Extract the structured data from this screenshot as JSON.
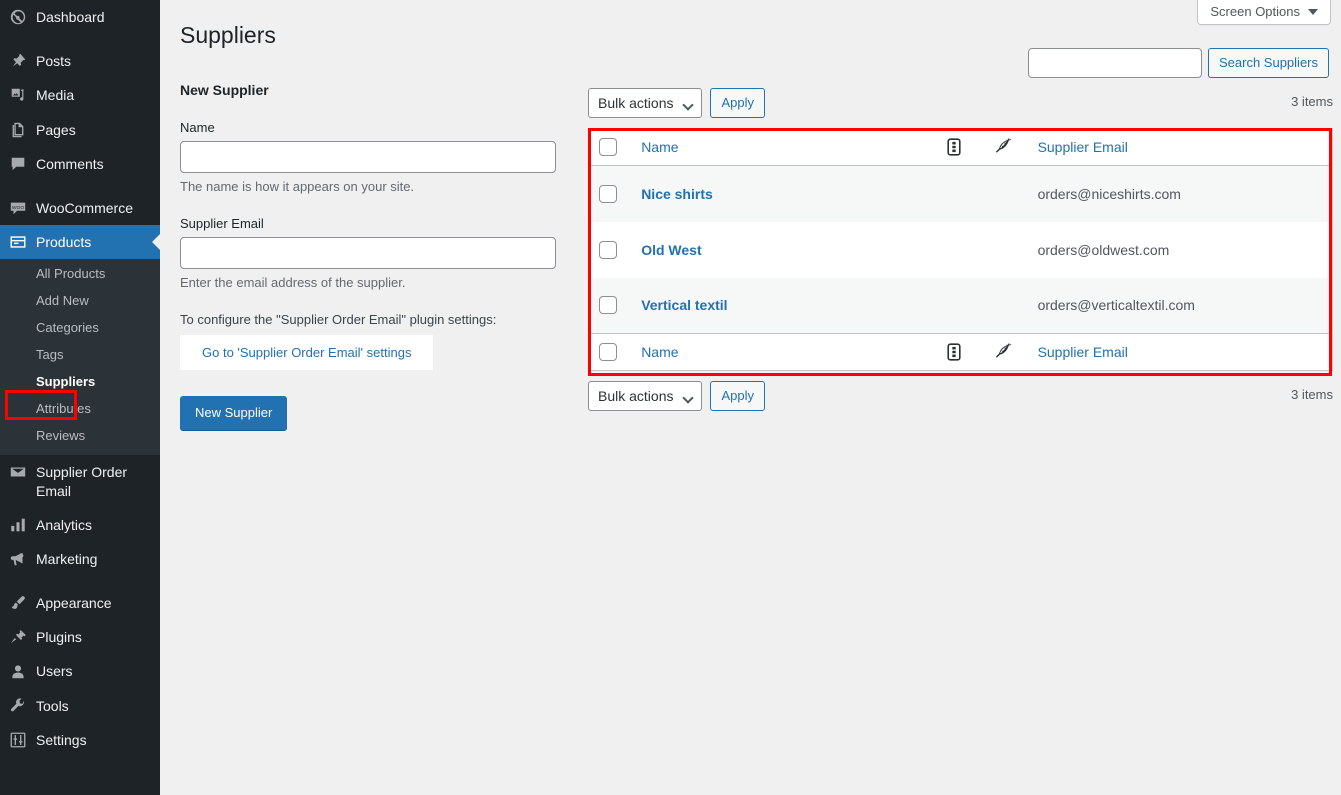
{
  "sidebar": {
    "items": [
      {
        "label": "Dashboard",
        "icon": "dashboard-icon",
        "current": false
      },
      {
        "label": "Posts",
        "icon": "pin-icon",
        "current": false
      },
      {
        "label": "Media",
        "icon": "media-icon",
        "current": false
      },
      {
        "label": "Pages",
        "icon": "pages-icon",
        "current": false
      },
      {
        "label": "Comments",
        "icon": "comments-icon",
        "current": false
      },
      {
        "label": "WooCommerce",
        "icon": "woocommerce-icon",
        "current": false
      },
      {
        "label": "Products",
        "icon": "products-icon",
        "current": true
      },
      {
        "label": "Supplier Order Email",
        "icon": "email-icon",
        "current": false
      },
      {
        "label": "Analytics",
        "icon": "analytics-icon",
        "current": false
      },
      {
        "label": "Marketing",
        "icon": "megaphone-icon",
        "current": false
      },
      {
        "label": "Appearance",
        "icon": "brush-icon",
        "current": false
      },
      {
        "label": "Plugins",
        "icon": "plug-icon",
        "current": false
      },
      {
        "label": "Users",
        "icon": "user-icon",
        "current": false
      },
      {
        "label": "Tools",
        "icon": "wrench-icon",
        "current": false
      },
      {
        "label": "Settings",
        "icon": "settings-icon",
        "current": false
      }
    ],
    "products_submenu": [
      {
        "label": "All Products",
        "current": false
      },
      {
        "label": "Add New",
        "current": false
      },
      {
        "label": "Categories",
        "current": false
      },
      {
        "label": "Tags",
        "current": false
      },
      {
        "label": "Suppliers",
        "current": true
      },
      {
        "label": "Attributes",
        "current": false
      },
      {
        "label": "Reviews",
        "current": false
      }
    ]
  },
  "screen_meta": {
    "screen_options_label": "Screen Options",
    "caret_icon": "caret-down-icon"
  },
  "header": {
    "page_title": "Suppliers"
  },
  "search": {
    "value": "",
    "placeholder": "",
    "button_label": "Search Suppliers"
  },
  "form": {
    "heading": "New Supplier",
    "name_label": "Name",
    "name_value": "",
    "name_help": "The name is how it appears on your site.",
    "email_label": "Supplier Email",
    "email_value": "",
    "email_help": "Enter the email address of the supplier.",
    "configure_text": "To configure the \"Supplier Order Email\" plugin settings:",
    "settings_link_label": "Go to 'Supplier Order Email' settings",
    "submit_label": "New Supplier"
  },
  "tablenav_top": {
    "bulk_label": "Bulk actions",
    "apply_label": "Apply",
    "items_count": "3 items"
  },
  "tablenav_bottom": {
    "bulk_label": "Bulk actions",
    "apply_label": "Apply",
    "items_count": "3 items"
  },
  "table": {
    "columns": {
      "name": "Name",
      "count_icon": "post-count-icon",
      "pen_icon": "feather-quill-icon",
      "email": "Supplier Email"
    },
    "rows": [
      {
        "name": "Nice shirts",
        "email": "orders@niceshirts.com"
      },
      {
        "name": "Old West",
        "email": "orders@oldwest.com"
      },
      {
        "name": "Vertical textil",
        "email": "orders@verticaltextil.com"
      }
    ]
  },
  "highlights": {
    "color": "#ff0000"
  }
}
